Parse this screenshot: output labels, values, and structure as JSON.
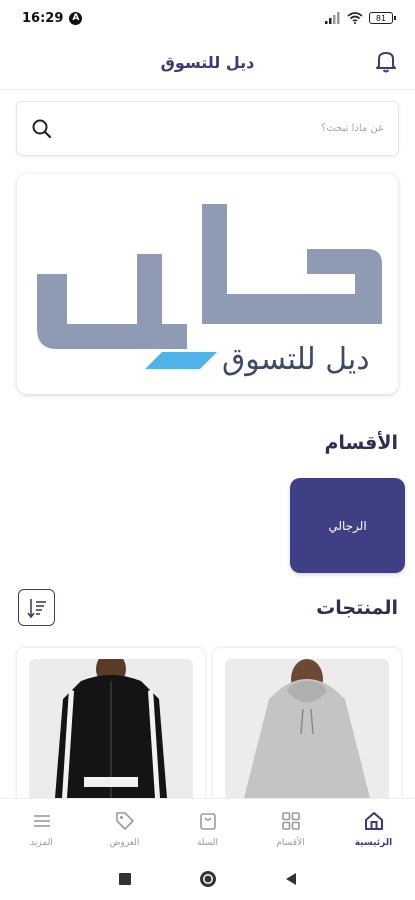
{
  "status": {
    "time": "16:29",
    "badge": "A",
    "battery": "81"
  },
  "header": {
    "title": "ديل للتسوق",
    "icon": "bell-icon"
  },
  "search": {
    "placeholder": "عن ماذا تبحث؟",
    "icon": "search-icon"
  },
  "banner": {
    "logo_text": "ديل للتسوق",
    "brand_color": "#8f9bb3",
    "accent_color": "#4fb3e8"
  },
  "sections": {
    "categories": "الأقسام",
    "products": "المنتجات"
  },
  "categories": [
    {
      "label": "الرجالي"
    }
  ],
  "products": [
    {
      "name": "grey-hoodie",
      "color": "#c6c6c6"
    },
    {
      "name": "black-jacket",
      "color": "#141414"
    }
  ],
  "bottom_nav": [
    {
      "label": "الرئيسية",
      "icon": "home-icon",
      "active": true
    },
    {
      "label": "الأقسام",
      "icon": "grid-icon",
      "active": false
    },
    {
      "label": "السلة",
      "icon": "cart-icon",
      "active": false
    },
    {
      "label": "العروض",
      "icon": "tag-icon",
      "active": false
    },
    {
      "label": "المزيد",
      "icon": "menu-icon",
      "active": false
    }
  ],
  "colors": {
    "primary": "#3f3f86",
    "title": "#3b3b78"
  }
}
